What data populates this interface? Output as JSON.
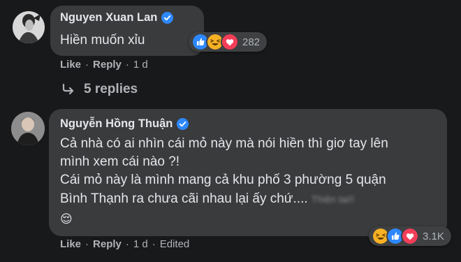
{
  "comments": [
    {
      "author": "Nguyen Xuan Lan",
      "lines": [
        "Hiền muốn xỉu"
      ],
      "reaction_count": "282",
      "actions": {
        "like": "Like",
        "reply": "Reply",
        "time": "1 d"
      }
    },
    {
      "author": "Nguyễn Hồng Thuận",
      "lines": [
        "Cả nhà có ai nhìn cái mỏ này mà nói hiền thì giơ tay lên",
        "mình xem cái nào ?!",
        "Cái mỏ này là mình mang cả khu phố 3 phường 5 quận",
        "Bình Thạnh ra chưa cãi nhau lại ấy chứ....",
        "😌"
      ],
      "blurred_tag": "Thiện tai!!",
      "reaction_count": "3.1K",
      "actions": {
        "like": "Like",
        "reply": "Reply",
        "time": "1 d",
        "edited": "Edited"
      }
    }
  ],
  "replies_link": "5 replies",
  "colors": {
    "background": "#18191a",
    "bubble": "#3a3b3c",
    "verified": "#2d88ff",
    "like": "#2d88ff",
    "love": "#f33e58",
    "haha": "#f7b125"
  }
}
